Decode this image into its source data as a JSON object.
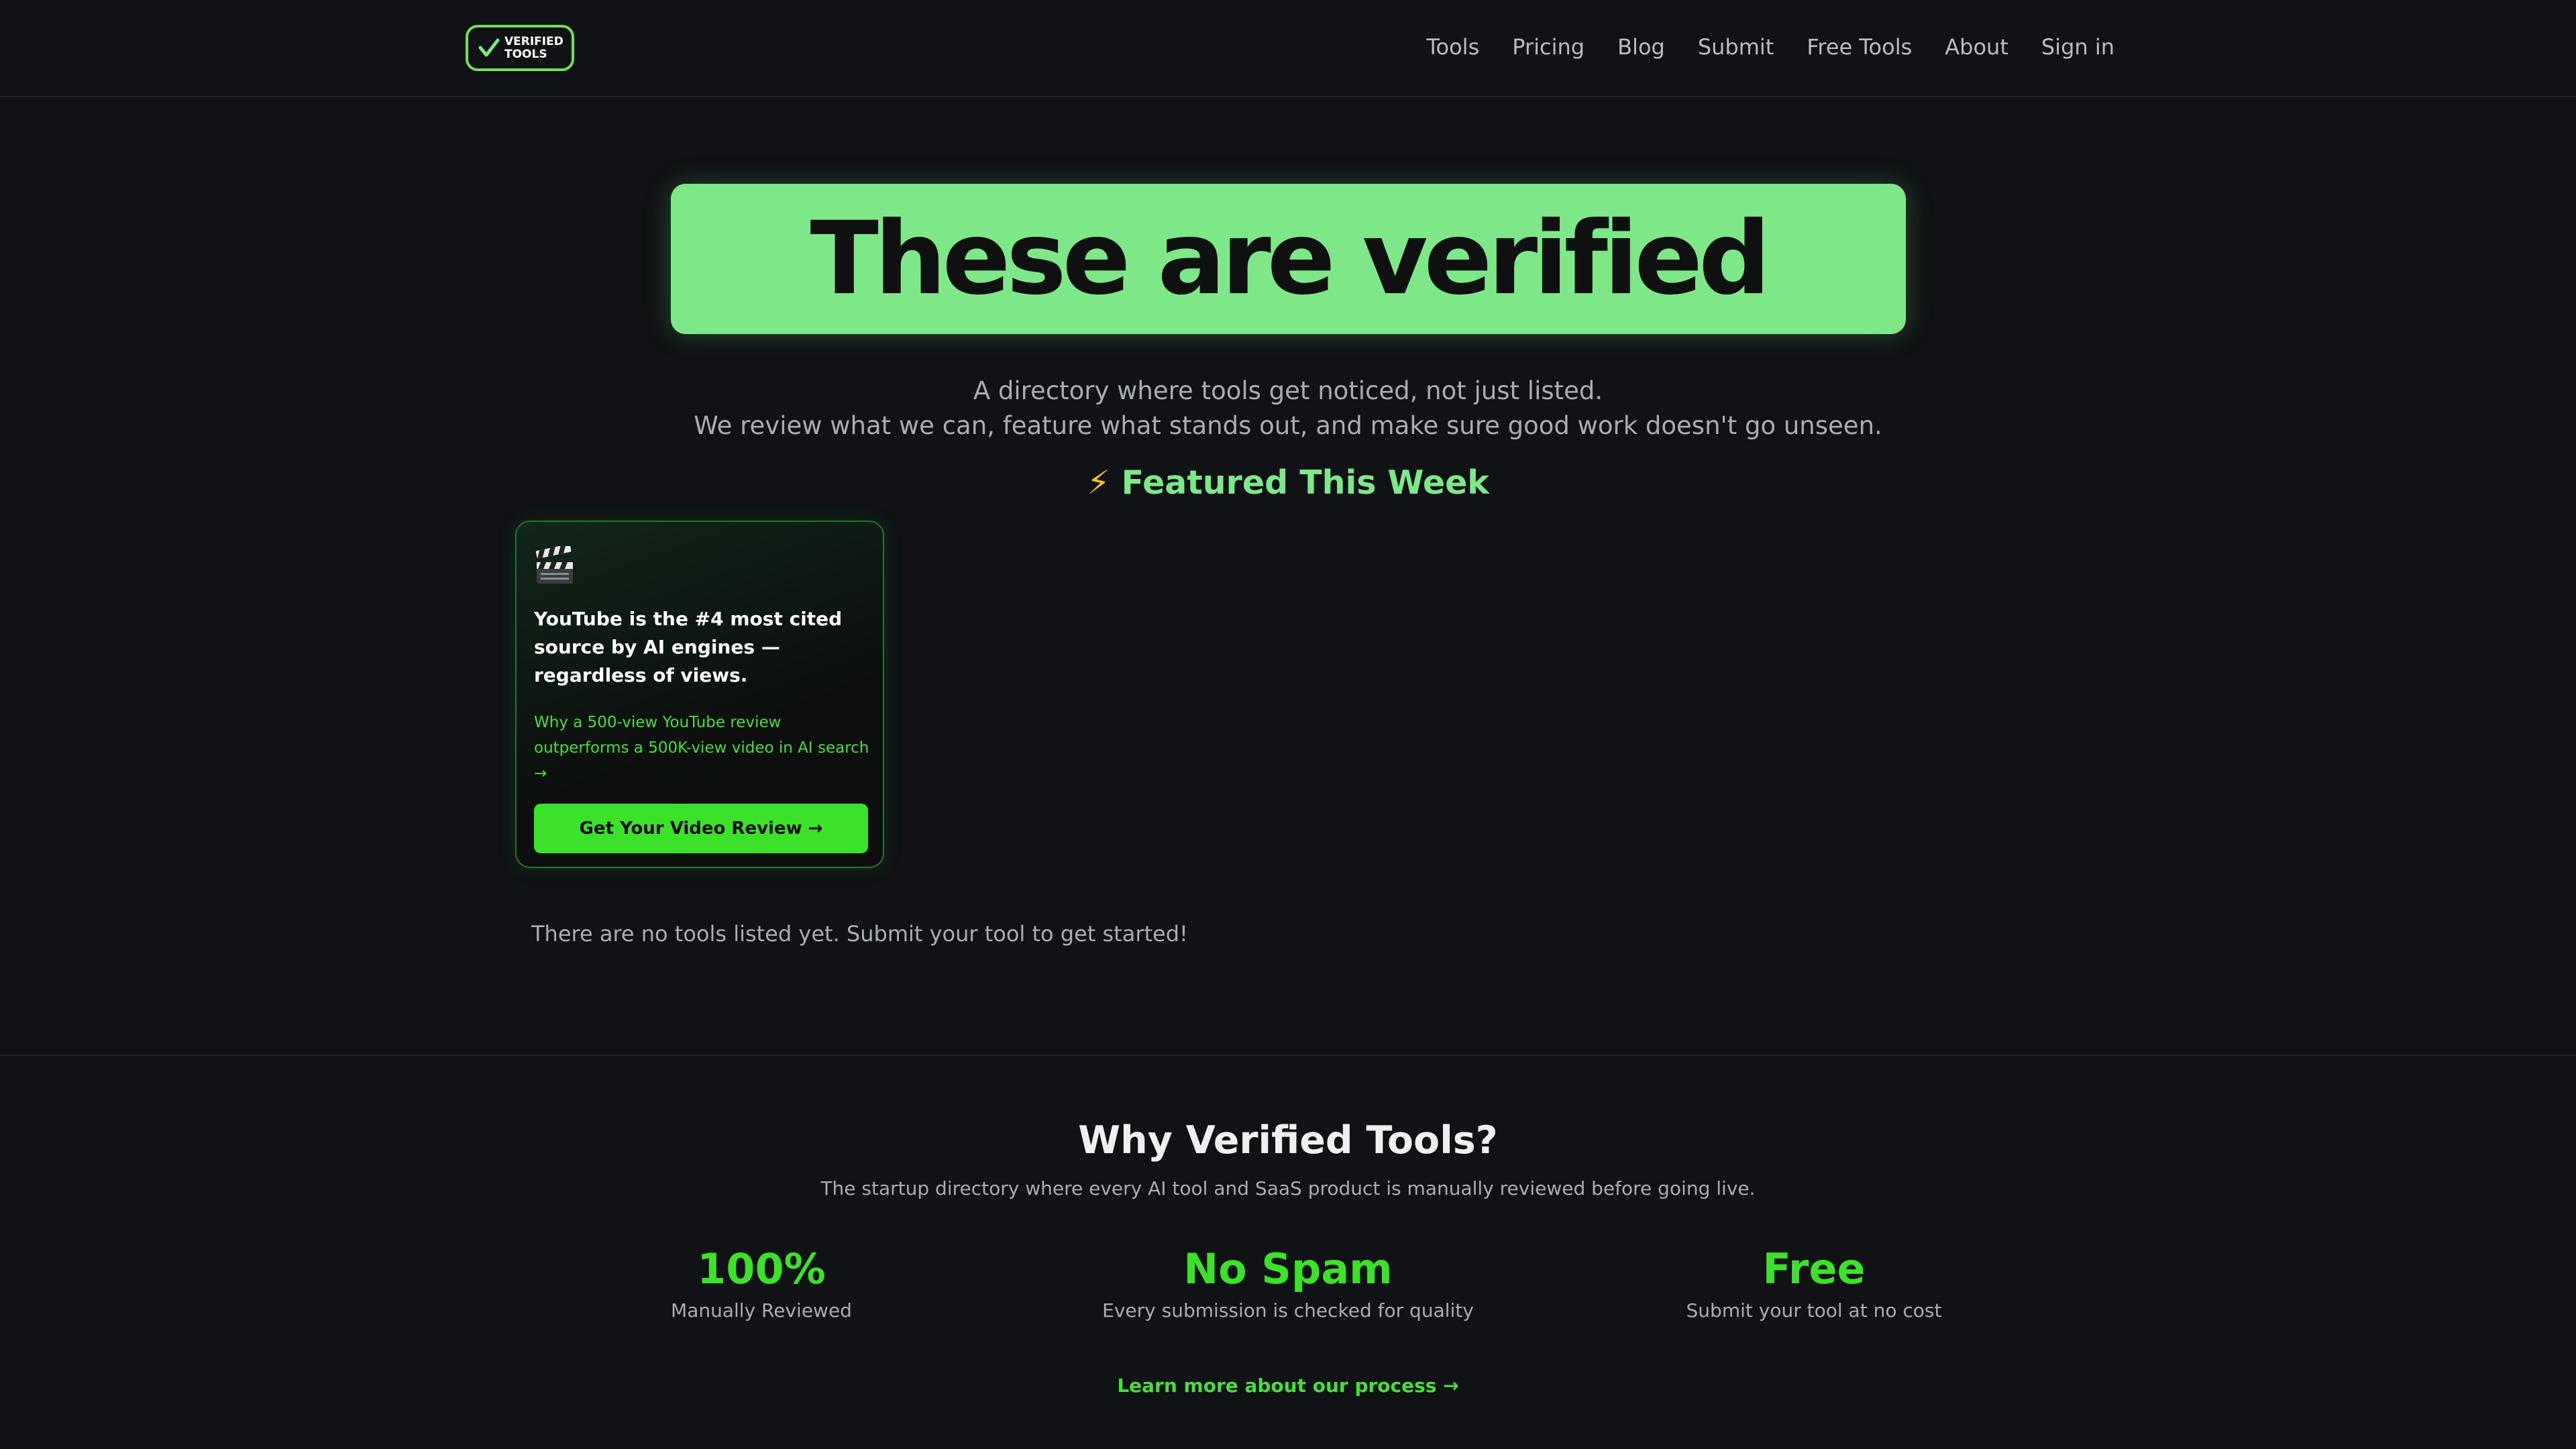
{
  "header": {
    "logo_text": "VERIFIED TOOLS",
    "nav": [
      "Tools",
      "Pricing",
      "Blog",
      "Submit",
      "Free Tools",
      "About",
      "Sign in"
    ]
  },
  "hero": {
    "title": "These are verified",
    "subtitle_line1": "A directory where tools get noticed, not just listed.",
    "subtitle_line2": "We review what we can, feature what stands out, and make sure good work doesn't go unseen."
  },
  "featured": {
    "icon": "⚡",
    "heading": "Featured This Week",
    "card": {
      "icon": "clapperboard-icon",
      "title": "YouTube is the #4 most cited source by AI engines — regardless of views.",
      "description": "Why a 500-view YouTube review outperforms a 500K-view video in AI search →",
      "button_label": "Get Your Video Review →"
    }
  },
  "empty_message": "There are no tools listed yet. Submit your tool to get started!",
  "why": {
    "title": "Why Verified Tools?",
    "subtitle": "The startup directory where every AI tool and SaaS product is manually reviewed before going live.",
    "stats": [
      {
        "value": "100%",
        "label": "Manually Reviewed"
      },
      {
        "value": "No Spam",
        "label": "Every submission is checked for quality"
      },
      {
        "value": "Free",
        "label": "Submit your tool at no cost"
      }
    ],
    "learn_more": "Learn more about our process →"
  },
  "colors": {
    "background": "#101215",
    "accent_green": "#7ee787",
    "bright_green": "#3ce12a"
  }
}
